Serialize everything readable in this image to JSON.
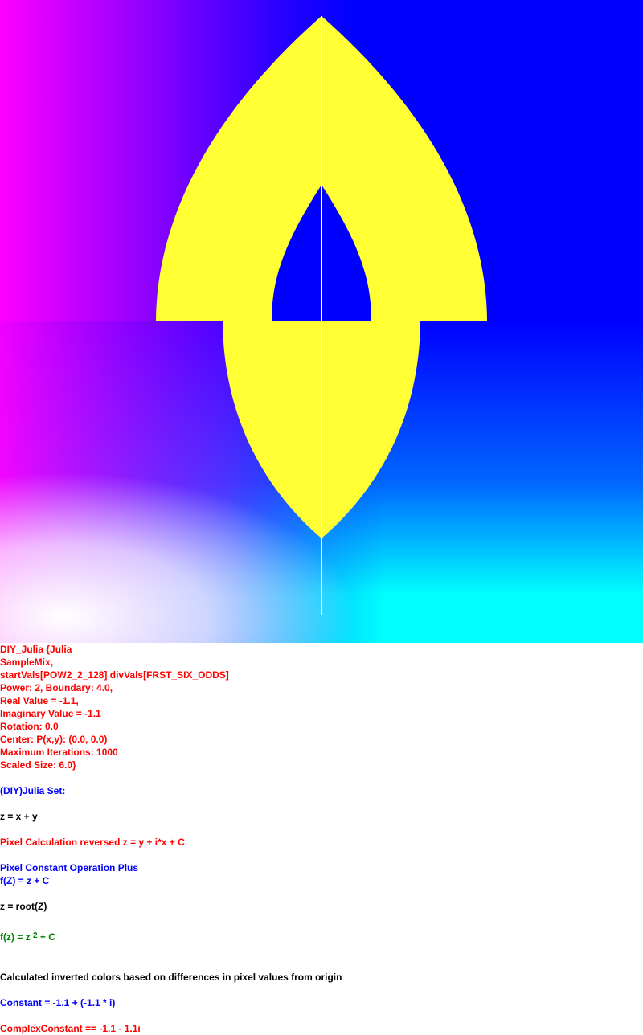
{
  "fractal_image": {
    "colors": {
      "background_pink": "#ff00ff",
      "background_blue": "#0000ff",
      "background_cyan": "#00ffff",
      "fill": "#ffff33",
      "axis": "#ffffff"
    }
  },
  "info": {
    "header_lines": [
      "DIY_Julia {Julia",
      "SampleMix,",
      "startVals[POW2_2_128] divVals[FRST_SIX_ODDS]",
      "Power: 2, Boundary: 4.0,",
      "Real Value = -1.1,",
      "Imaginary Value = -1.1",
      "Rotation: 0.0",
      "Center: P(x,y): (0.0, 0.0)",
      "Maximum Iterations: 1000",
      "Scaled Size: 6.0}"
    ],
    "set_title": "(DIY)Julia Set:",
    "z_def": "z = x + y",
    "pixel_calc": "Pixel Calculation reversed z = y + i*x + C",
    "constant_op": "Pixel Constant Operation Plus",
    "fz_plus": "f(Z) = z + C",
    "z_root": "z = root(Z)",
    "fz_power": {
      "prefix": "f(z) = z ",
      "exponent": "2",
      "suffix": " + C"
    },
    "colors_note": "Calculated inverted colors based on differences in pixel values from origin",
    "constant": "Constant = -1.1 + (-1.1 * i)",
    "complex_constant": "ComplexConstant == -1.1 - 1.1i"
  }
}
